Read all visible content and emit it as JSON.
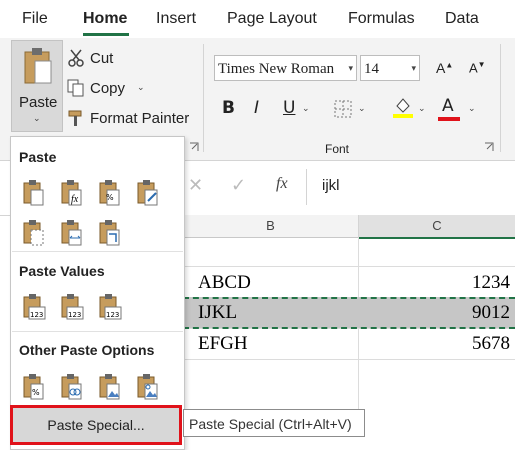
{
  "tabs": [
    {
      "label": "File",
      "active": false
    },
    {
      "label": "Home",
      "active": true
    },
    {
      "label": "Insert",
      "active": false
    },
    {
      "label": "Page Layout",
      "active": false
    },
    {
      "label": "Formulas",
      "active": false
    },
    {
      "label": "Data",
      "active": false
    }
  ],
  "ribbon": {
    "paste_label": "Paste",
    "cut_label": "Cut",
    "copy_label": "Copy",
    "format_painter_label": "Format Painter",
    "font_name": "Times New Roman",
    "font_size": "14",
    "font_group_label": "Font",
    "bold": "B",
    "italic": "I",
    "underline": "U",
    "font_color_letter": "A",
    "fx": "fx"
  },
  "formula_bar": {
    "value": "ijkl"
  },
  "columns": [
    "B",
    "C"
  ],
  "cells": [
    {
      "b": "ABCD",
      "c": "1234"
    },
    {
      "b": "IJKL",
      "c": "9012"
    },
    {
      "b": "EFGH",
      "c": "5678"
    }
  ],
  "paste_menu": {
    "section_paste": "Paste",
    "section_values": "Paste Values",
    "section_other": "Other Paste Options",
    "paste_special_label": "Paste Special...",
    "tooltip": "Paste Special (Ctrl+Alt+V)"
  },
  "colors": {
    "accent": "#217346",
    "highlight_yellow": "#ffff00",
    "font_red": "#e0121a",
    "callout_border": "#e0121a"
  }
}
